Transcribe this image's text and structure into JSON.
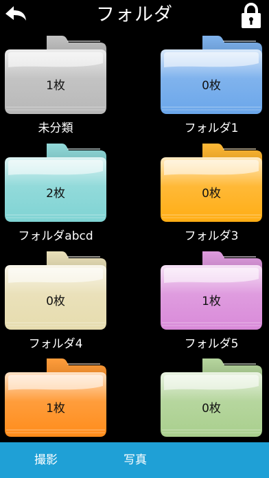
{
  "header": {
    "title": "フォルダ",
    "back_icon": "back-arrow-icon",
    "lock_icon": "lock-icon"
  },
  "folders": [
    {
      "name": "未分類",
      "count": "1枚",
      "color": "#b8b8b8"
    },
    {
      "name": "フォルダ1",
      "count": "0枚",
      "color": "#6aa6ea"
    },
    {
      "name": "フォルダabcd",
      "count": "2枚",
      "color": "#7fd3d3"
    },
    {
      "name": "フォルダ3",
      "count": "0枚",
      "color": "#ffad14"
    },
    {
      "name": "フォルダ4",
      "count": "0枚",
      "color": "#e6dcae"
    },
    {
      "name": "フォルダ5",
      "count": "1枚",
      "color": "#d98ad9"
    },
    {
      "name": "",
      "count": "1枚",
      "color": "#ff8c1a"
    },
    {
      "name": "",
      "count": "0枚",
      "color": "#a9cf8d"
    }
  ],
  "tabbar": {
    "tabs": [
      {
        "label": "撮影"
      },
      {
        "label": "写真"
      }
    ],
    "color": "#1fa0d6"
  }
}
